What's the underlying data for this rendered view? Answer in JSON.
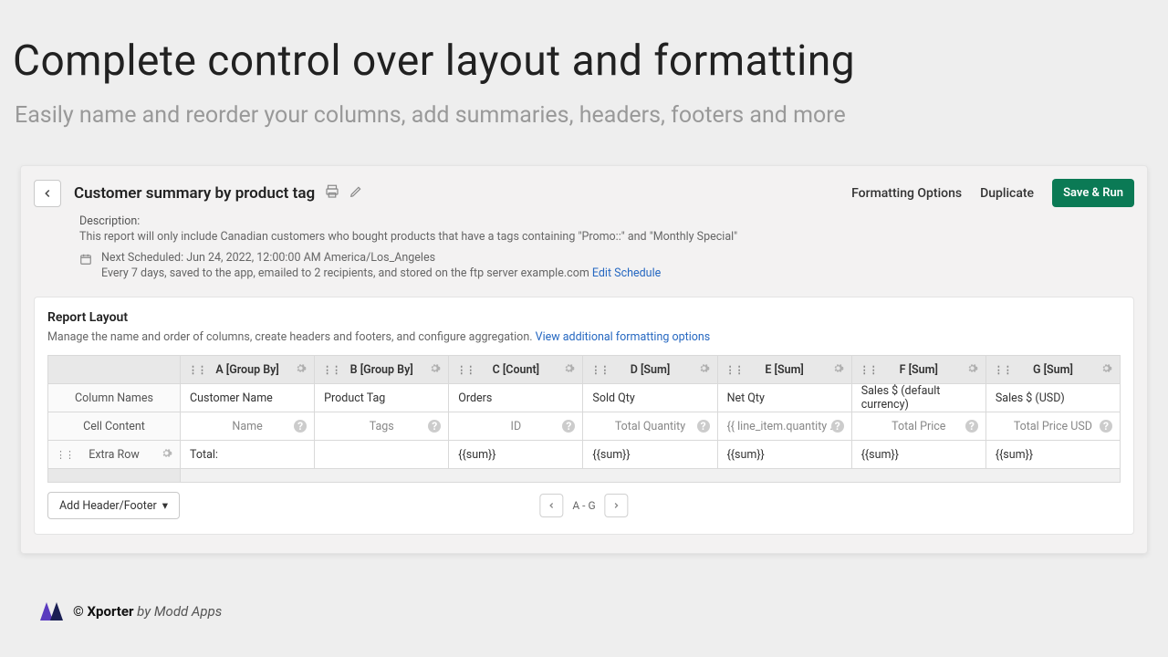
{
  "page": {
    "heading": "Complete control over layout and formatting",
    "subheading": "Easily name and reorder your columns, add summaries, headers, footers and more"
  },
  "header": {
    "title": "Customer summary by product tag",
    "formatting_options": "Formatting Options",
    "duplicate": "Duplicate",
    "save_run": "Save & Run"
  },
  "meta": {
    "description_label": "Description:",
    "description_text": "This report will only include Canadian customers who bought products that have a tags containing \"Promo::\" and \"Monthly Special\"",
    "next_scheduled": "Next Scheduled: Jun 24, 2022, 12:00:00 AM America/Los_Angeles",
    "schedule_line": "Every 7 days, saved to the app, emailed to 2 recipients, and stored on the ftp server example.com ",
    "edit_schedule": "Edit Schedule"
  },
  "layout": {
    "title": "Report Layout",
    "desc": "Manage the name and order of columns, create headers and footers, and configure aggregation.",
    "view_more": "View additional formatting options",
    "row_labels": {
      "column_names": "Column Names",
      "cell_content": "Cell Content",
      "extra_row": "Extra Row"
    },
    "columns": [
      {
        "header": "A [Group By]",
        "name": "Customer Name",
        "content": "Name",
        "extra": "Total:"
      },
      {
        "header": "B [Group By]",
        "name": "Product Tag",
        "content": "Tags",
        "extra": ""
      },
      {
        "header": "C [Count]",
        "name": "Orders",
        "content": "ID",
        "extra": "{{sum}}"
      },
      {
        "header": "D [Sum]",
        "name": "Sold Qty",
        "content": "Total Quantity",
        "extra": "{{sum}}"
      },
      {
        "header": "E [Sum]",
        "name": "Net Qty",
        "content": "{{ line_item.quantity * line_it",
        "extra": "{{sum}}"
      },
      {
        "header": "F [Sum]",
        "name": "Sales $ (default currency)",
        "content": "Total Price",
        "extra": "{{sum}}"
      },
      {
        "header": "G [Sum]",
        "name": "Sales $ (USD)",
        "content": "Total Price USD",
        "extra": "{{sum}}"
      }
    ],
    "add_header_footer": "Add Header/Footer",
    "pager_text": "A - G"
  },
  "footer": {
    "copyright": "© ",
    "product": "Xporter",
    "by": " by Modd Apps"
  }
}
